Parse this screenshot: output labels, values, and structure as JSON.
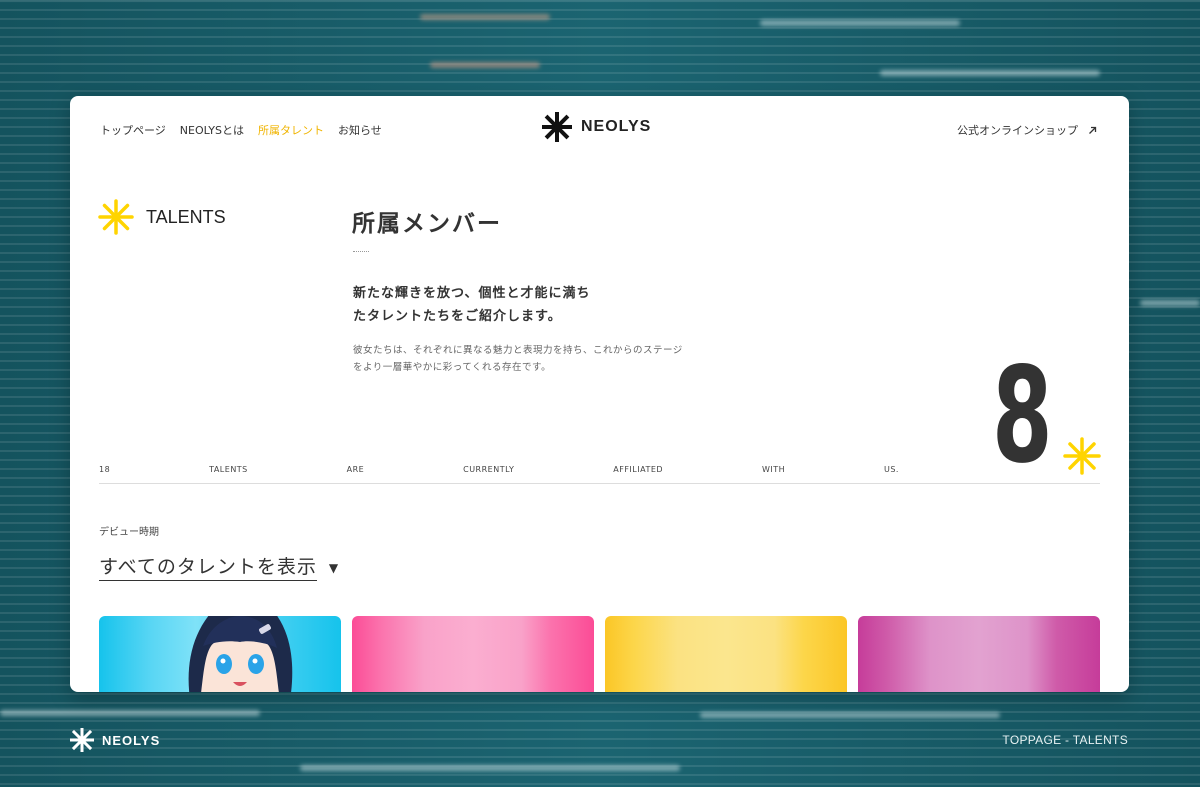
{
  "nav": {
    "items": [
      {
        "label": "トップページ",
        "active": false
      },
      {
        "label": "NEOLYSとは",
        "active": false
      },
      {
        "label": "所属タレント",
        "active": true
      },
      {
        "label": "お知らせ",
        "active": false
      }
    ],
    "brand": "NEOLYS",
    "shop_label": "公式オンラインショップ",
    "shop_icon": "external-arrow-icon"
  },
  "section": {
    "label": "TALENTS",
    "title": "所属メンバー",
    "lead_line1": "新たな輝きを放つ、個性と才能に満ち",
    "lead_line2": "たタレントたちをご紹介します。",
    "description": "彼女たちは、それぞれに異なる魅力と表現力を持ち、これからのステージをより一層華やかに彩ってくれる存在です。",
    "count_display": "8"
  },
  "ticker": [
    "18",
    "TALENTS",
    "ARE",
    "CURRENTLY",
    "AFFILIATED",
    "WITH",
    "US."
  ],
  "filter": {
    "label": "デビュー時期",
    "selected": "すべてのタレントを表示",
    "icon": "dropdown-triangle-icon"
  },
  "tiles": [
    {
      "color": "#2cc8ee"
    },
    {
      "color": "#f75aa0"
    },
    {
      "color": "#fbd34a"
    },
    {
      "color": "#cc55ac"
    }
  ],
  "footer": {
    "brand": "NEOLYS",
    "breadcrumb": "TOPPAGE - TALENTS"
  },
  "colors": {
    "accent": "#f0b400",
    "asterisk": "#ffd400",
    "background": "#195f6b"
  }
}
